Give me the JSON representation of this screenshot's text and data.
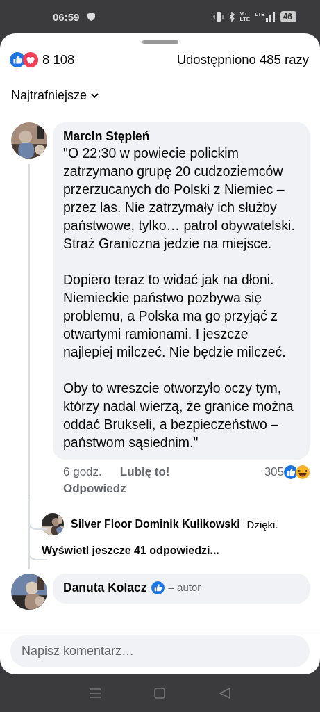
{
  "status_bar": {
    "time": "06:59",
    "volte_top": "Vo",
    "volte_bottom": "LTE",
    "signal_label": "LTE",
    "battery": "46"
  },
  "reactions": {
    "count": "8 108",
    "shares": "Udostępniono 485 razy"
  },
  "sort": {
    "label": "Najtrafniejsze"
  },
  "comments": [
    {
      "author": "Marcin Stępień",
      "author_badge": false,
      "paragraphs": [
        "\"O 22:30 w powiecie polickim zatrzymano grupę 20 cudzoziemców przerzucanych do Polski z Niemiec – przez las. Nie zatrzymały ich służby państwowe, tylko… patrol obywatelski. Straż Graniczna jedzie na miejsce.",
        "Dopiero teraz to widać jak na dłoni. Niemieckie państwo pozbywa się problemu, a Polska ma go przyjąć z otwartymi ramionami. I jeszcze najlepiej milczeć. Nie będzie milczeć.",
        "Oby to wreszcie otworzyło oczy tym, którzy nadal wierzą, że granice można oddać Brukseli, a bezpieczeństwo – państwom sąsiednim.\""
      ],
      "time": "6 godz.",
      "like": "Lubię to!",
      "reply": "Odpowiedz",
      "reaction_count": "305",
      "replies": [
        {
          "author": "Silver Floor Dominik Kulikowski",
          "text": "Dzięki."
        }
      ],
      "more_replies": "Wyświetl jeszcze 41 odpowiedzi..."
    },
    {
      "author": "Danuta Kolacz",
      "author_badge": true,
      "author_role": "– autor"
    }
  ],
  "composer": {
    "placeholder": "Napisz komentarz…"
  }
}
